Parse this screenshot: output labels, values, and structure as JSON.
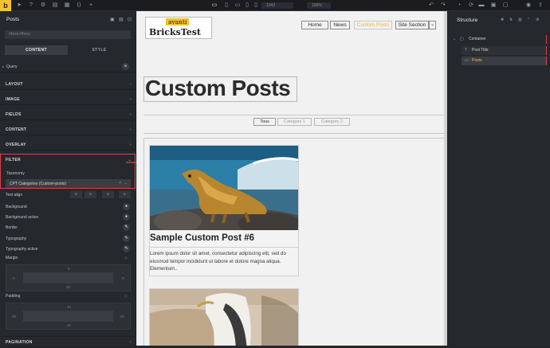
{
  "topbar": {
    "logo": "b",
    "width_value": "1043",
    "height_value": "100%",
    "icons": [
      "cursor-icon",
      "help-icon",
      "settings-icon",
      "layers-icon",
      "template-icon",
      "code-icon",
      "add-icon",
      "desktop-icon",
      "laptop-icon",
      "tablet-landscape-icon",
      "tablet-portrait-icon",
      "mobile-icon",
      "undo-icon",
      "redo-icon",
      "history-icon",
      "revisions-icon",
      "folder-icon",
      "templates-icon",
      "pages-icon",
      "preview-icon",
      "publish-icon"
    ]
  },
  "left_panel": {
    "title": "Posts",
    "element_id": "#brxe-tfhnxz",
    "tabs": [
      "CONTENT",
      "STYLE"
    ],
    "query_label": "Query",
    "sections": [
      "LAYOUT",
      "IMAGE",
      "FIELDS",
      "CONTENT",
      "OVERLAY",
      "FILTER",
      "PAGINATION"
    ],
    "taxonomy_label": "Taxonomy",
    "taxonomy_value": "CPT Categories (Custom-posts)",
    "style_rows": [
      "Text align",
      "Background",
      "Background active",
      "Border",
      "Typography",
      "Typography active"
    ],
    "margin_label": "Margin",
    "margin_values": {
      "top": "0",
      "right": "0",
      "bottom": "20",
      "left": "0"
    },
    "padding_label": "Padding",
    "padding_values": {
      "top": "10",
      "right": "20",
      "bottom": "10",
      "left": "20"
    }
  },
  "canvas": {
    "brand_top": "avanti",
    "brand_bottom": "BricksTest",
    "nav": [
      "Home",
      "News",
      "Custom Posts",
      "Site Section"
    ],
    "page_title": "Custom Posts",
    "filter_tabs": [
      "Tous",
      "Category 1",
      "Category 2"
    ],
    "post1_title": "Sample Custom Post #6",
    "post1_excerpt": "Lorem ipsum dolor sit amet, consectetur adipiscing elit, sed do eiusmod tempor incididunt ut labore et dolore magna aliqua. Elementum.."
  },
  "structure": {
    "title": "Structure",
    "items": [
      "Container",
      "Post Title",
      "Posts"
    ]
  },
  "colors": {
    "accent": "#f5c22d",
    "highlight": "#d9434b",
    "nav_active": "#e8b23a"
  }
}
